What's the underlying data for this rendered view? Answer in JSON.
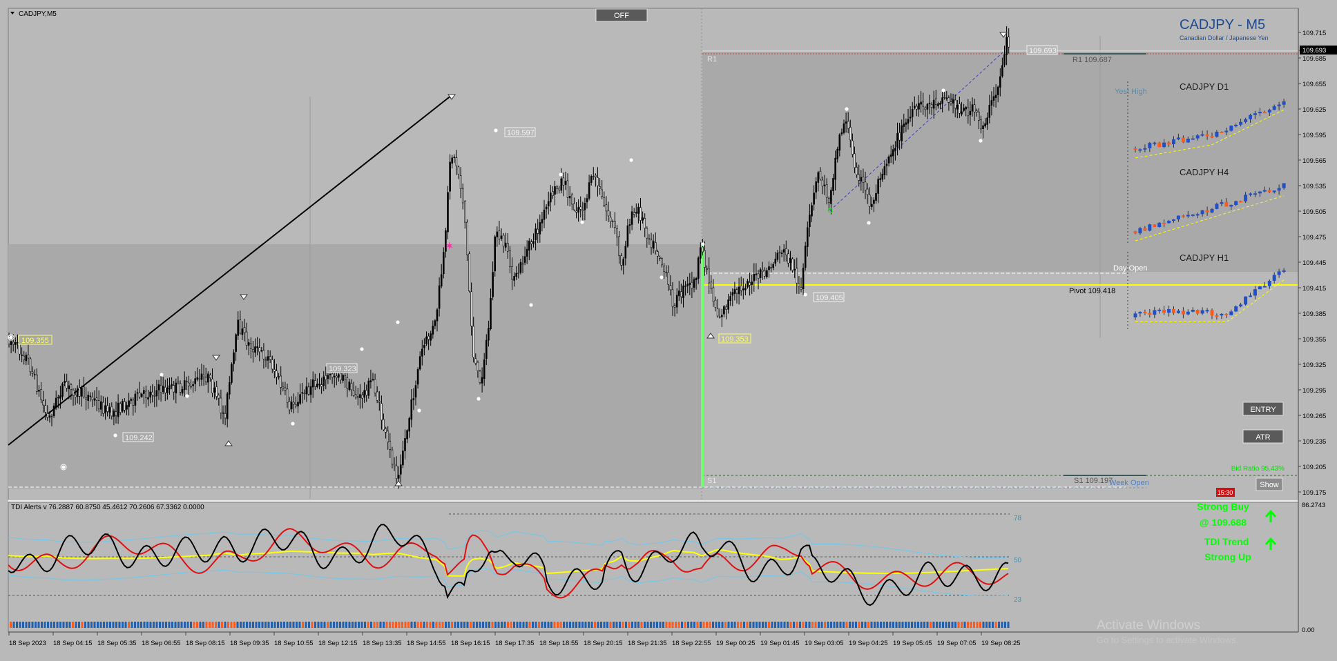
{
  "window": {
    "title": "CADJPY,M5",
    "off_button": "OFF"
  },
  "header": {
    "symbol_title": "CADJPY - M5",
    "symbol_desc": "Canadian Dollar / Japanese Yen"
  },
  "price_axis": {
    "labels": [
      "109.715",
      "109.685",
      "109.655",
      "109.625",
      "109.595",
      "109.565",
      "109.535",
      "109.505",
      "109.475",
      "109.445",
      "109.415",
      "109.385",
      "109.355",
      "109.325",
      "109.295",
      "109.265",
      "109.235",
      "109.205",
      "109.175"
    ],
    "current_price": "109.693"
  },
  "levels": {
    "r1_tag": "R1",
    "r1_label": "R1 109.687",
    "s1_tag": "S1",
    "s1_label": "S1 109.197",
    "pivot_label": "Pivot 109.418",
    "day_open": "Day Open",
    "week_open": "Week Open",
    "yest_high": "Yest High"
  },
  "price_tags": {
    "left_yellow": "109.355",
    "low_white": "109.242",
    "mid_white": "109.323",
    "peak_white": "109.597",
    "post_white": "109.405",
    "post_yellow": "109.353",
    "top_white": "109.693"
  },
  "mini_charts": [
    {
      "label": "CADJPY  D1"
    },
    {
      "label": "CADJPY  H4"
    },
    {
      "label": "CADJPY  H1"
    }
  ],
  "buttons": {
    "entry": "ENTRY",
    "atr": "ATR",
    "show": "Show"
  },
  "bid_ratio": "Bid Ratio 95.43%",
  "time_badge": "15:30",
  "indicator": {
    "header": "TDI Alerts v 76.2887 60.8750 45.4612 70.2606 67.3362 0.0000",
    "axis_top": "86.2743",
    "axis_bottom": "0.00",
    "levels": [
      "78",
      "50",
      "23"
    ],
    "signal_line1": "Strong Buy",
    "signal_line2": "@ 109.688",
    "trend_line1": "TDI Trend",
    "trend_line2": "Strong Up"
  },
  "time_axis": [
    "18 Sep 2023",
    "18 Sep 04:15",
    "18 Sep 05:35",
    "18 Sep 06:55",
    "18 Sep 08:15",
    "18 Sep 09:35",
    "18 Sep 10:55",
    "18 Sep 12:15",
    "18 Sep 13:35",
    "18 Sep 14:55",
    "18 Sep 16:15",
    "18 Sep 17:35",
    "18 Sep 18:55",
    "18 Sep 20:15",
    "18 Sep 21:35",
    "18 Sep 22:55",
    "19 Sep 00:25",
    "19 Sep 01:45",
    "19 Sep 03:05",
    "19 Sep 04:25",
    "19 Sep 05:45",
    "19 Sep 07:05",
    "19 Sep 08:25"
  ],
  "watermark": {
    "line1": "Activate Windows",
    "line2": "Go to Settings to activate Windows."
  },
  "colors": {
    "background": "#b9b9b9",
    "zone": "#a9a9a9",
    "pivot": "#ffff00",
    "bull": "#1f4fc9",
    "bear": "#ff5a1e",
    "accent_green": "#00ff00",
    "title_blue": "#1d4a8f"
  }
}
